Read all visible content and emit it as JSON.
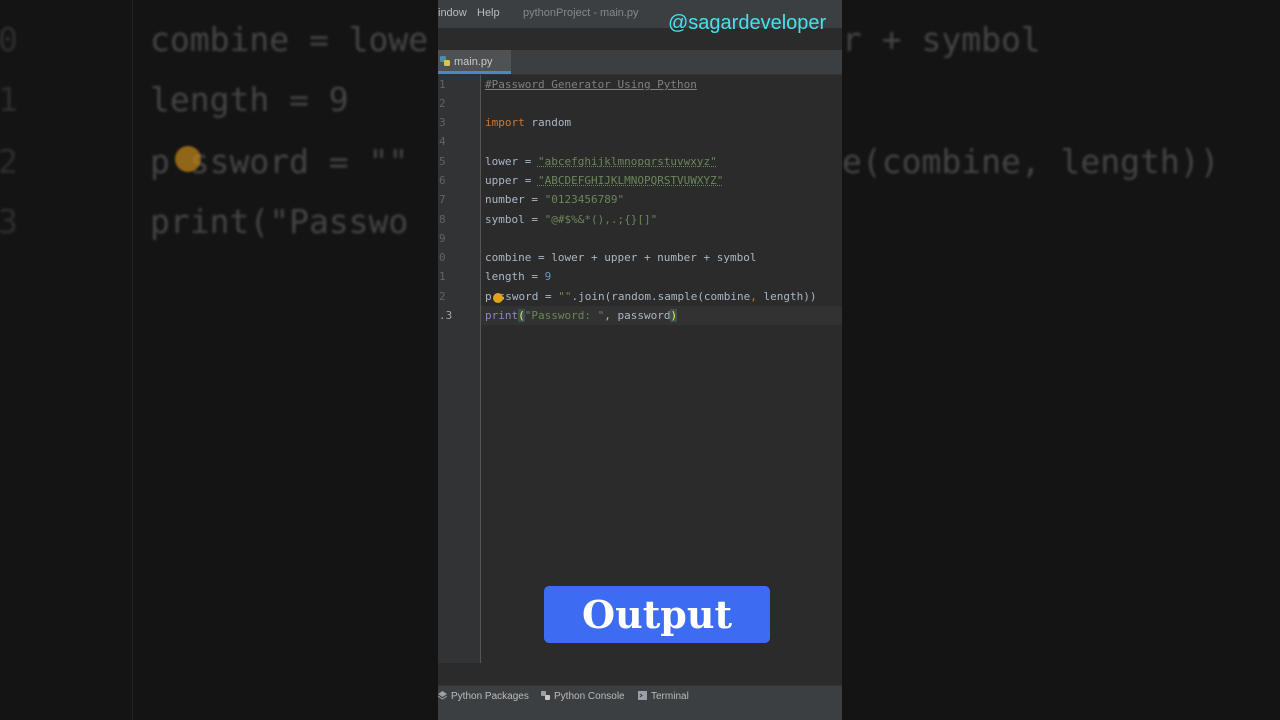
{
  "menu": {
    "window_label": "indow",
    "help_label": "Help",
    "title": "pythonProject - main.py"
  },
  "watermark": "@sagardeveloper",
  "tab": {
    "label": "main.py",
    "icon": "python-file-icon"
  },
  "code": {
    "line_numbers": [
      "1",
      "2",
      "3",
      "4",
      "5",
      "6",
      "7",
      "8",
      "9",
      "0",
      "1",
      "2",
      ".3"
    ],
    "comment": "#Password Generator Using Python",
    "import_kw": "import",
    "import_mod": " random",
    "lower_name": "lower = ",
    "lower_val": "\"abcefghijklmnopqrstuvwxyz\"",
    "upper_name": "upper = ",
    "upper_val": "\"ABCDEFGHIJKLMNOPQRSTVUWXYZ\"",
    "number_name": "number = ",
    "number_val": "\"0123456789\"",
    "symbol_name": "symbol = ",
    "symbol_val": "\"@#$%&*(),.;{}[]\"",
    "combine_line": "combine = lower + upper + number + symbol",
    "length_name": "length = ",
    "length_val": "9",
    "password_a": "p",
    "password_b": "ssword = ",
    "password_str": "\"\"",
    "password_c": ".join(random.sample(combine",
    "password_comma": ",",
    "password_d": " length))",
    "print_kw": "print",
    "print_open": "(",
    "print_str": "\"Password: \"",
    "print_rest": ", password",
    "print_close": ")"
  },
  "background": {
    "line_a": "combine = lowe",
    "line_a_right": "r + symbol",
    "line_b": "length = 9",
    "line_c": "p ssword = \"\"",
    "line_c_right": "e(combine, length))",
    "line_d": "print(\"Passwo",
    "nums": [
      "0",
      "1",
      "2",
      "3"
    ]
  },
  "output_button": "Output",
  "toolwindows": {
    "packages": "Python Packages",
    "console": "Python Console",
    "terminal": "Terminal"
  },
  "colors": {
    "watermark": "#43e3ee",
    "output_button": "#3d6cf2",
    "tab_underline": "#4a88c7"
  }
}
